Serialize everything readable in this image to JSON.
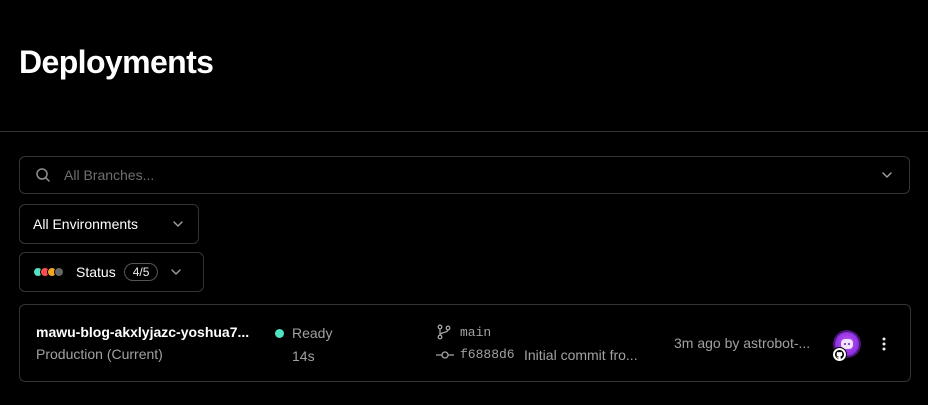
{
  "header": {
    "title": "Deployments"
  },
  "filters": {
    "search_placeholder": "All Branches...",
    "environment_label": "All Environments",
    "status_label": "Status",
    "status_count": "4/5",
    "status_colors": [
      "#50e3c2",
      "#ff4d4d",
      "#f5a623",
      "#666666"
    ]
  },
  "deployments": [
    {
      "name": "mawu-blog-akxlyjazc-yoshua7...",
      "environment": "Production (Current)",
      "status": "Ready",
      "status_color": "#50e3c2",
      "duration": "14s",
      "branch": "main",
      "commit_hash": "f6888d6",
      "commit_message": "Initial commit fro...",
      "time_by": "3m ago by astrobot-..."
    }
  ],
  "icons": {
    "search": "search-icon",
    "chevron": "chevron-down-icon",
    "branch": "git-branch-icon",
    "commit": "git-commit-icon",
    "github": "github-icon",
    "more": "more-vertical-icon"
  }
}
